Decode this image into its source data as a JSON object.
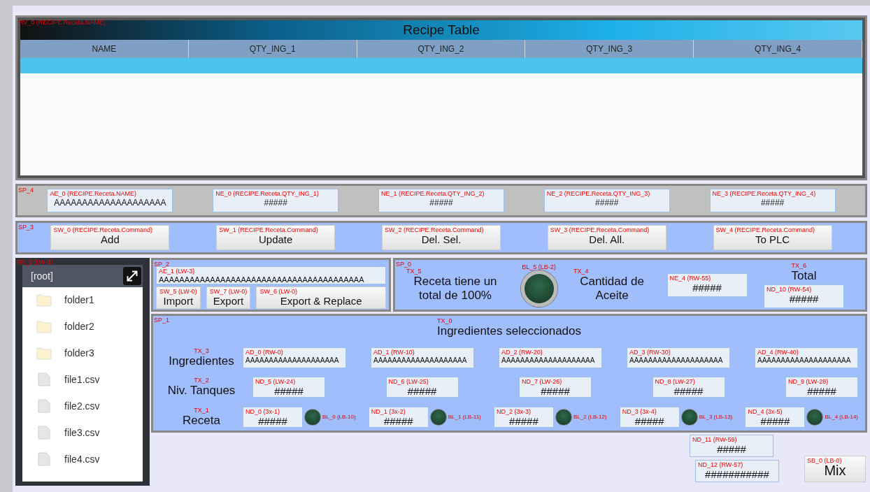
{
  "recipe_view": {
    "tag": "RV_0 (RECIPE.Receta.NAME)",
    "title": "Recipe Table",
    "columns": [
      "NAME",
      "QTY_ING_1",
      "QTY_ING_2",
      "QTY_ING_3",
      "QTY_ING_4"
    ],
    "rows": [
      {
        "selected": true
      }
    ]
  },
  "entry_panel": {
    "tag": "SP_4",
    "fields": [
      {
        "tag": "AE_0 (RECIPE.Receta.NAME)",
        "value": "AAAAAAAAAAAAAAAAAAAA"
      },
      {
        "tag": "NE_0 (RECIPE.Receta.QTY_ING_1)",
        "value": "#####"
      },
      {
        "tag": "NE_1 (RECIPE.Receta.QTY_ING_2)",
        "value": "#####"
      },
      {
        "tag": "NE_2 (RECIPE.Receta.QTY_ING_3)",
        "value": "#####"
      },
      {
        "tag": "NE_3 (RECIPE.Receta.QTY_ING_4)",
        "value": "#####"
      }
    ]
  },
  "command_panel": {
    "tag": "SP_3",
    "buttons": [
      {
        "tag": "SW_0 (RECIPE.Receta.Command)",
        "label": "Add"
      },
      {
        "tag": "SW_1 (RECIPE.Receta.Command)",
        "label": "Update"
      },
      {
        "tag": "SW_2 (RECIPE.Receta.Command)",
        "label": "Del. Sel."
      },
      {
        "tag": "SW_3 (RECIPE.Receta.Command)",
        "label": "Del. All."
      },
      {
        "tag": "SW_4 (RECIPE.Receta.Command)",
        "label": "To PLC"
      }
    ]
  },
  "file_browser": {
    "tag": "FR_0 (LW-3)",
    "root": "[root]",
    "items": [
      {
        "kind": "folder",
        "name": "folder1"
      },
      {
        "kind": "folder",
        "name": "folder2"
      },
      {
        "kind": "folder",
        "name": "folder3"
      },
      {
        "kind": "file",
        "name": "file1.csv"
      },
      {
        "kind": "file",
        "name": "file2.csv"
      },
      {
        "kind": "file",
        "name": "file3.csv"
      },
      {
        "kind": "file",
        "name": "file4.csv"
      }
    ]
  },
  "import_panel": {
    "tag": "SP_2",
    "field": {
      "tag": "AE_1 (LW-3)",
      "value": "AAAAAAAAAAAAAAAAAAAAAAAAAAAAAAAAAAAAAAAA"
    },
    "buttons": [
      {
        "tag": "SW_5 (LW-0)",
        "label": "Import"
      },
      {
        "tag": "SW_7 (LW-0)",
        "label": "Export"
      },
      {
        "tag": "SW_6 (LW-0)",
        "label": "Export & Replace"
      }
    ]
  },
  "status_panel": {
    "tag": "SP_0",
    "message": {
      "tag": "TX_5",
      "text": "Receta tiene un total de 100%"
    },
    "lamp": {
      "tag": "BL_5 (LB-2)"
    },
    "oil_label": {
      "tag": "TX_4",
      "text": "Cantidad de Aceite"
    },
    "oil_field": {
      "tag": "NE_4 (RW-55)",
      "value": "#####"
    },
    "total_label": {
      "tag": "TX_6",
      "text": "Total"
    },
    "total_field": {
      "tag": "ND_10 (RW-54)",
      "value": "#####"
    }
  },
  "ingredients_panel": {
    "tag": "SP_1",
    "title": {
      "tag": "TX_0",
      "text": "Ingredientes seleccionados"
    },
    "rows": [
      {
        "kind": "text",
        "label": {
          "tag": "TX_3",
          "text": "Ingredientes"
        },
        "fields": [
          {
            "tag": "AD_0 (RW-0)",
            "value": "AAAAAAAAAAAAAAAAAAAA"
          },
          {
            "tag": "AD_1 (RW-10)",
            "value": "AAAAAAAAAAAAAAAAAAAA"
          },
          {
            "tag": "AD_2 (RW-20)",
            "value": "AAAAAAAAAAAAAAAAAAAA"
          },
          {
            "tag": "AD_3 (RW-30)",
            "value": "AAAAAAAAAAAAAAAAAAAA"
          },
          {
            "tag": "AD_4 (RW-40)",
            "value": "AAAAAAAAAAAAAAAAAAAA"
          }
        ]
      },
      {
        "kind": "number",
        "label": {
          "tag": "TX_2",
          "text": "Niv. Tanques"
        },
        "fields": [
          {
            "tag": "ND_5 (LW-24)",
            "value": "#####"
          },
          {
            "tag": "ND_6 (LW-25)",
            "value": "#####"
          },
          {
            "tag": "ND_7 (LW-26)",
            "value": "#####"
          },
          {
            "tag": "ND_8 (LW-27)",
            "value": "#####"
          },
          {
            "tag": "ND_9 (LW-28)",
            "value": "#####"
          }
        ]
      },
      {
        "kind": "lamp",
        "label": {
          "tag": "TX_1",
          "text": "Receta"
        },
        "fields": [
          {
            "tag": "ND_0 (3x-1)",
            "value": "#####",
            "lamp_tag": "BL_0 (LB-10)"
          },
          {
            "tag": "ND_1 (3x-2)",
            "value": "#####",
            "lamp_tag": "BL_1 (LB-11)"
          },
          {
            "tag": "ND_2 (3x-3)",
            "value": "#####",
            "lamp_tag": "BL_2 (LB-12)"
          },
          {
            "tag": "ND_3 (3x-4)",
            "value": "#####",
            "lamp_tag": "BL_3 (LB-13)"
          },
          {
            "tag": "ND_4 (3x-5)",
            "value": "#####",
            "lamp_tag": "BL_4 (LB-14)"
          }
        ]
      }
    ]
  },
  "extra_fields": [
    {
      "tag": "ND_11 (RW-59)",
      "value": "#####"
    },
    {
      "tag": "ND_12 (RW-57)",
      "value": "###########"
    }
  ],
  "mix_button": {
    "tag": "SB_0 (LB-0)",
    "label": "Mix"
  }
}
